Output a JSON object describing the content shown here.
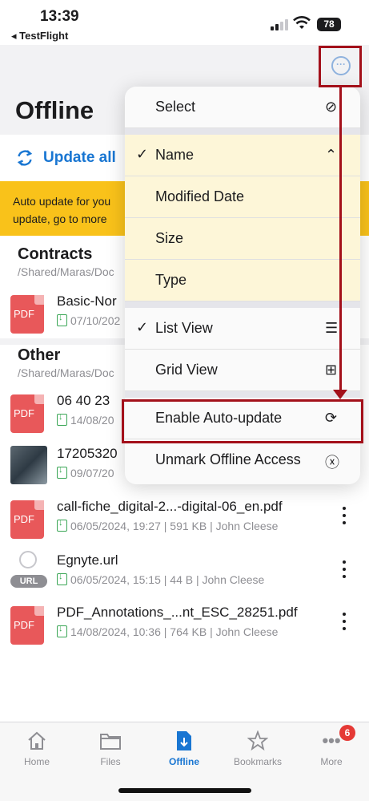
{
  "status": {
    "time": "13:39",
    "back_app": "◂ TestFlight",
    "battery": "78"
  },
  "page": {
    "title": "Offline",
    "update_all": "Update all"
  },
  "banner": {
    "line1": "Auto update for you",
    "line2": "update, go to more"
  },
  "sections": [
    {
      "title": "Contracts",
      "path": "/Shared/Maras/Doc"
    },
    {
      "title": "Other",
      "path": "/Shared/Maras/Doc"
    }
  ],
  "files": [
    {
      "name": "Basic-Nor",
      "meta": "07/10/202",
      "icon": "pdf-icon"
    },
    {
      "name": "06 40 23",
      "meta": "14/08/20",
      "icon": "pdf-icon"
    },
    {
      "name": "17205320",
      "meta": "09/07/20",
      "icon": "photo-thumbnail"
    },
    {
      "name": "call-fiche_digital-2...-digital-06_en.pdf",
      "meta": "06/05/2024, 19:27 | 591 KB | John Cleese",
      "icon": "pdf-icon"
    },
    {
      "name": "Egnyte.url",
      "meta": "06/05/2024, 15:15 | 44 B | John Cleese",
      "icon": "url-icon"
    },
    {
      "name": "PDF_Annotations_...nt_ESC_28251.pdf",
      "meta": "14/08/2024, 10:36 | 764 KB | John Cleese",
      "icon": "pdf-icon"
    }
  ],
  "pdf_label": "PDF",
  "url_label": "URL",
  "menu": {
    "select": "Select",
    "sort": [
      "Name",
      "Modified Date",
      "Size",
      "Type"
    ],
    "views": [
      "List View",
      "Grid View"
    ],
    "actions": [
      "Enable Auto-update",
      "Unmark Offline Access"
    ]
  },
  "tabs": [
    {
      "label": "Home",
      "icon": "home-icon"
    },
    {
      "label": "Files",
      "icon": "folder-icon"
    },
    {
      "label": "Offline",
      "icon": "offline-doc-icon",
      "active": true
    },
    {
      "label": "Bookmarks",
      "icon": "star-icon"
    },
    {
      "label": "More",
      "icon": "more-dots-icon"
    }
  ],
  "more_badge": "6",
  "colors": {
    "accent": "#1976d2",
    "banner": "#f9c21a",
    "pdf": "#e8585a",
    "annotation": "#a3101a"
  }
}
